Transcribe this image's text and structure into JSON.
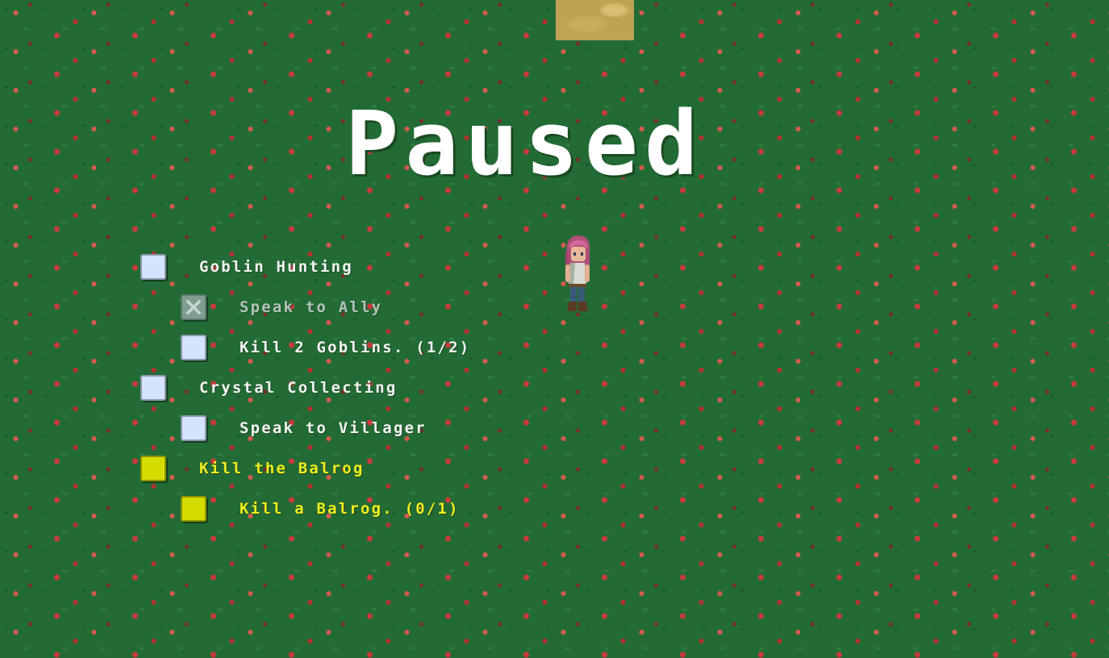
{
  "screen": {
    "title": "Paused",
    "state": "paused"
  },
  "quests": [
    {
      "name": "Goblin Hunting",
      "status": "open",
      "objectives": [
        {
          "label": "Speak to Ally",
          "status": "complete",
          "icon": "x-mark-icon"
        },
        {
          "label": "Kill 2 Goblins. (1/2)",
          "status": "open"
        }
      ]
    },
    {
      "name": "Crystal Collecting",
      "status": "open",
      "objectives": [
        {
          "label": "Speak to Villager",
          "status": "open"
        }
      ]
    },
    {
      "name": "Kill the Balrog",
      "status": "active",
      "objectives": [
        {
          "label": "Kill a Balrog. (0/1)",
          "status": "active"
        }
      ]
    }
  ],
  "colors": {
    "grass": "#236b35",
    "label_default": "#f4f4f4",
    "label_done": "#b3c2bb",
    "label_active": "#f0ee1e",
    "checkbox_default": "#d5e3ff",
    "checkbox_active": "#d4dc00"
  },
  "icons": {
    "player": "player-character-sprite",
    "checkbox_done": "x-mark-icon",
    "tile": "sand-tile"
  }
}
